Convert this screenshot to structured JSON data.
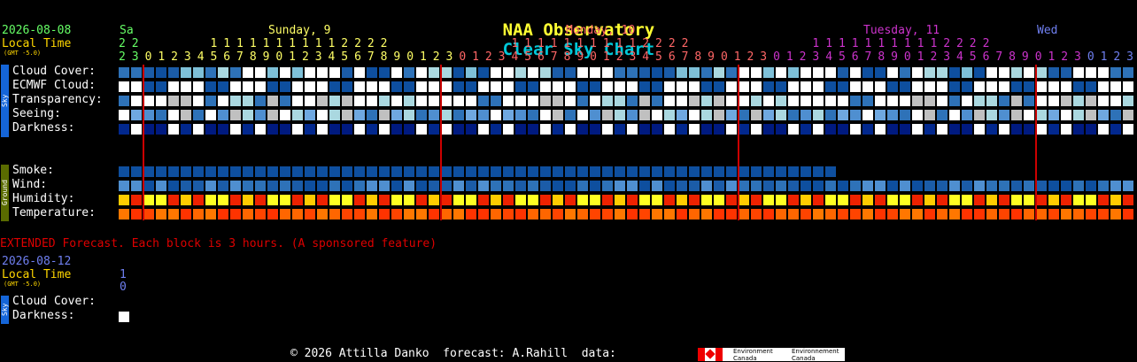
{
  "title": {
    "part1": "NAA Observatory",
    "part2": "Clear Sky Chart"
  },
  "header": {
    "date": "2026-08-08",
    "local_time": "Local Time",
    "gmt": "(GMT -5.0)"
  },
  "days": [
    {
      "label": "Sa",
      "color": "#66ff66"
    },
    {
      "label": "Sunday, 9",
      "color": "#ffff66"
    },
    {
      "label": "Monday, 10",
      "color": "#ff6666"
    },
    {
      "label": "Tuesday, 11",
      "color": "#cc33cc"
    },
    {
      "label": "Wed",
      "color": "#6f7ff0"
    }
  ],
  "hour_tens": "2 2           1 1 1 1 1 1 1 1 1 1 2 2 2 2                   1 1 1 1 1 1 1 1 1 1 2 2 2 2                   1 1 1 1 1 1 1 1 1 1 2 2 2 2",
  "hour_ones": "2 3 0 1 2 3 4 5 6 7 8 9 0 1 2 3 4 5 6 7 8 9 0 1 2 3 0 1 2 3 4 5 6 7 8 9 0 1 2 3 4 5 6 7 8 9 0 1 2 3 0 1 2 3 4 5 6 7 8 9 0 1 2 3 4 5 6 7 8 9 0 1 2 3 0 1 2 3 4 5 6 7",
  "sky_label": "Sky",
  "ground_label": "Ground",
  "rows": {
    "cloud": "Cloud Cover:",
    "ecmwf": "ECMWF Cloud:",
    "transparency": "Transparency:",
    "seeing": "Seeing:",
    "darkness": "Darkness:",
    "smoke": "Smoke:",
    "wind": "Wind:",
    "humidity": "Humidity:",
    "temperature": "Temperature:"
  },
  "extended": {
    "note": "EXTENDED Forecast. Each block is 3 hours. (A sponsored feature)",
    "date": "2026-08-12",
    "local_time": "Local Time",
    "gmt": "(GMT -5.0)",
    "hour_tens": "1",
    "hour_ones": "0",
    "cloud": "Cloud Cover:",
    "darkness": "Darkness:"
  },
  "footer": {
    "copyright": "© 2026 Attilla Danko  forecast: A.Rahill  data:",
    "env_en": "Environment Canada",
    "env_fr": "Environnement Canada"
  },
  "colors": {
    "title1": "#ffff33",
    "title2": "#00c8d8",
    "midnight_line": "#cc0000"
  }
}
